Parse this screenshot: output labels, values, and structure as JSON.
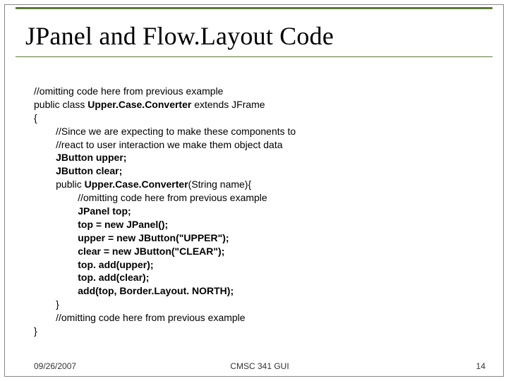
{
  "title": "JPanel and Flow.Layout Code",
  "code": {
    "l01": "//omitting code here from previous example",
    "l02a": "public class ",
    "l02b": "Upper.Case.Converter",
    "l02c": " extends JFrame",
    "l03": "{",
    "l04": "        //Since we are expecting to make these components to",
    "l05": "        //react to user interaction we make them object data",
    "l06": "        JButton upper;",
    "l07": "        JButton clear;",
    "l08a": "        public ",
    "l08b": "Upper.Case.Converter",
    "l08c": "(String name){",
    "l09": "                //omitting code here from previous example",
    "l10": "                JPanel top;",
    "l11": "                top = new JPanel();",
    "l12": "                upper = new JButton(\"UPPER\");",
    "l13": "                clear = new JButton(\"CLEAR\");",
    "l14": "                top. add(upper);",
    "l15": "                top. add(clear);",
    "l16": "                add(top, Border.Layout. NORTH);",
    "l17": "        }",
    "l18": "        //omitting code here from previous example",
    "l19": "}"
  },
  "footer": {
    "date": "09/26/2007",
    "course": "CMSC 341 GUI",
    "page": "14"
  }
}
